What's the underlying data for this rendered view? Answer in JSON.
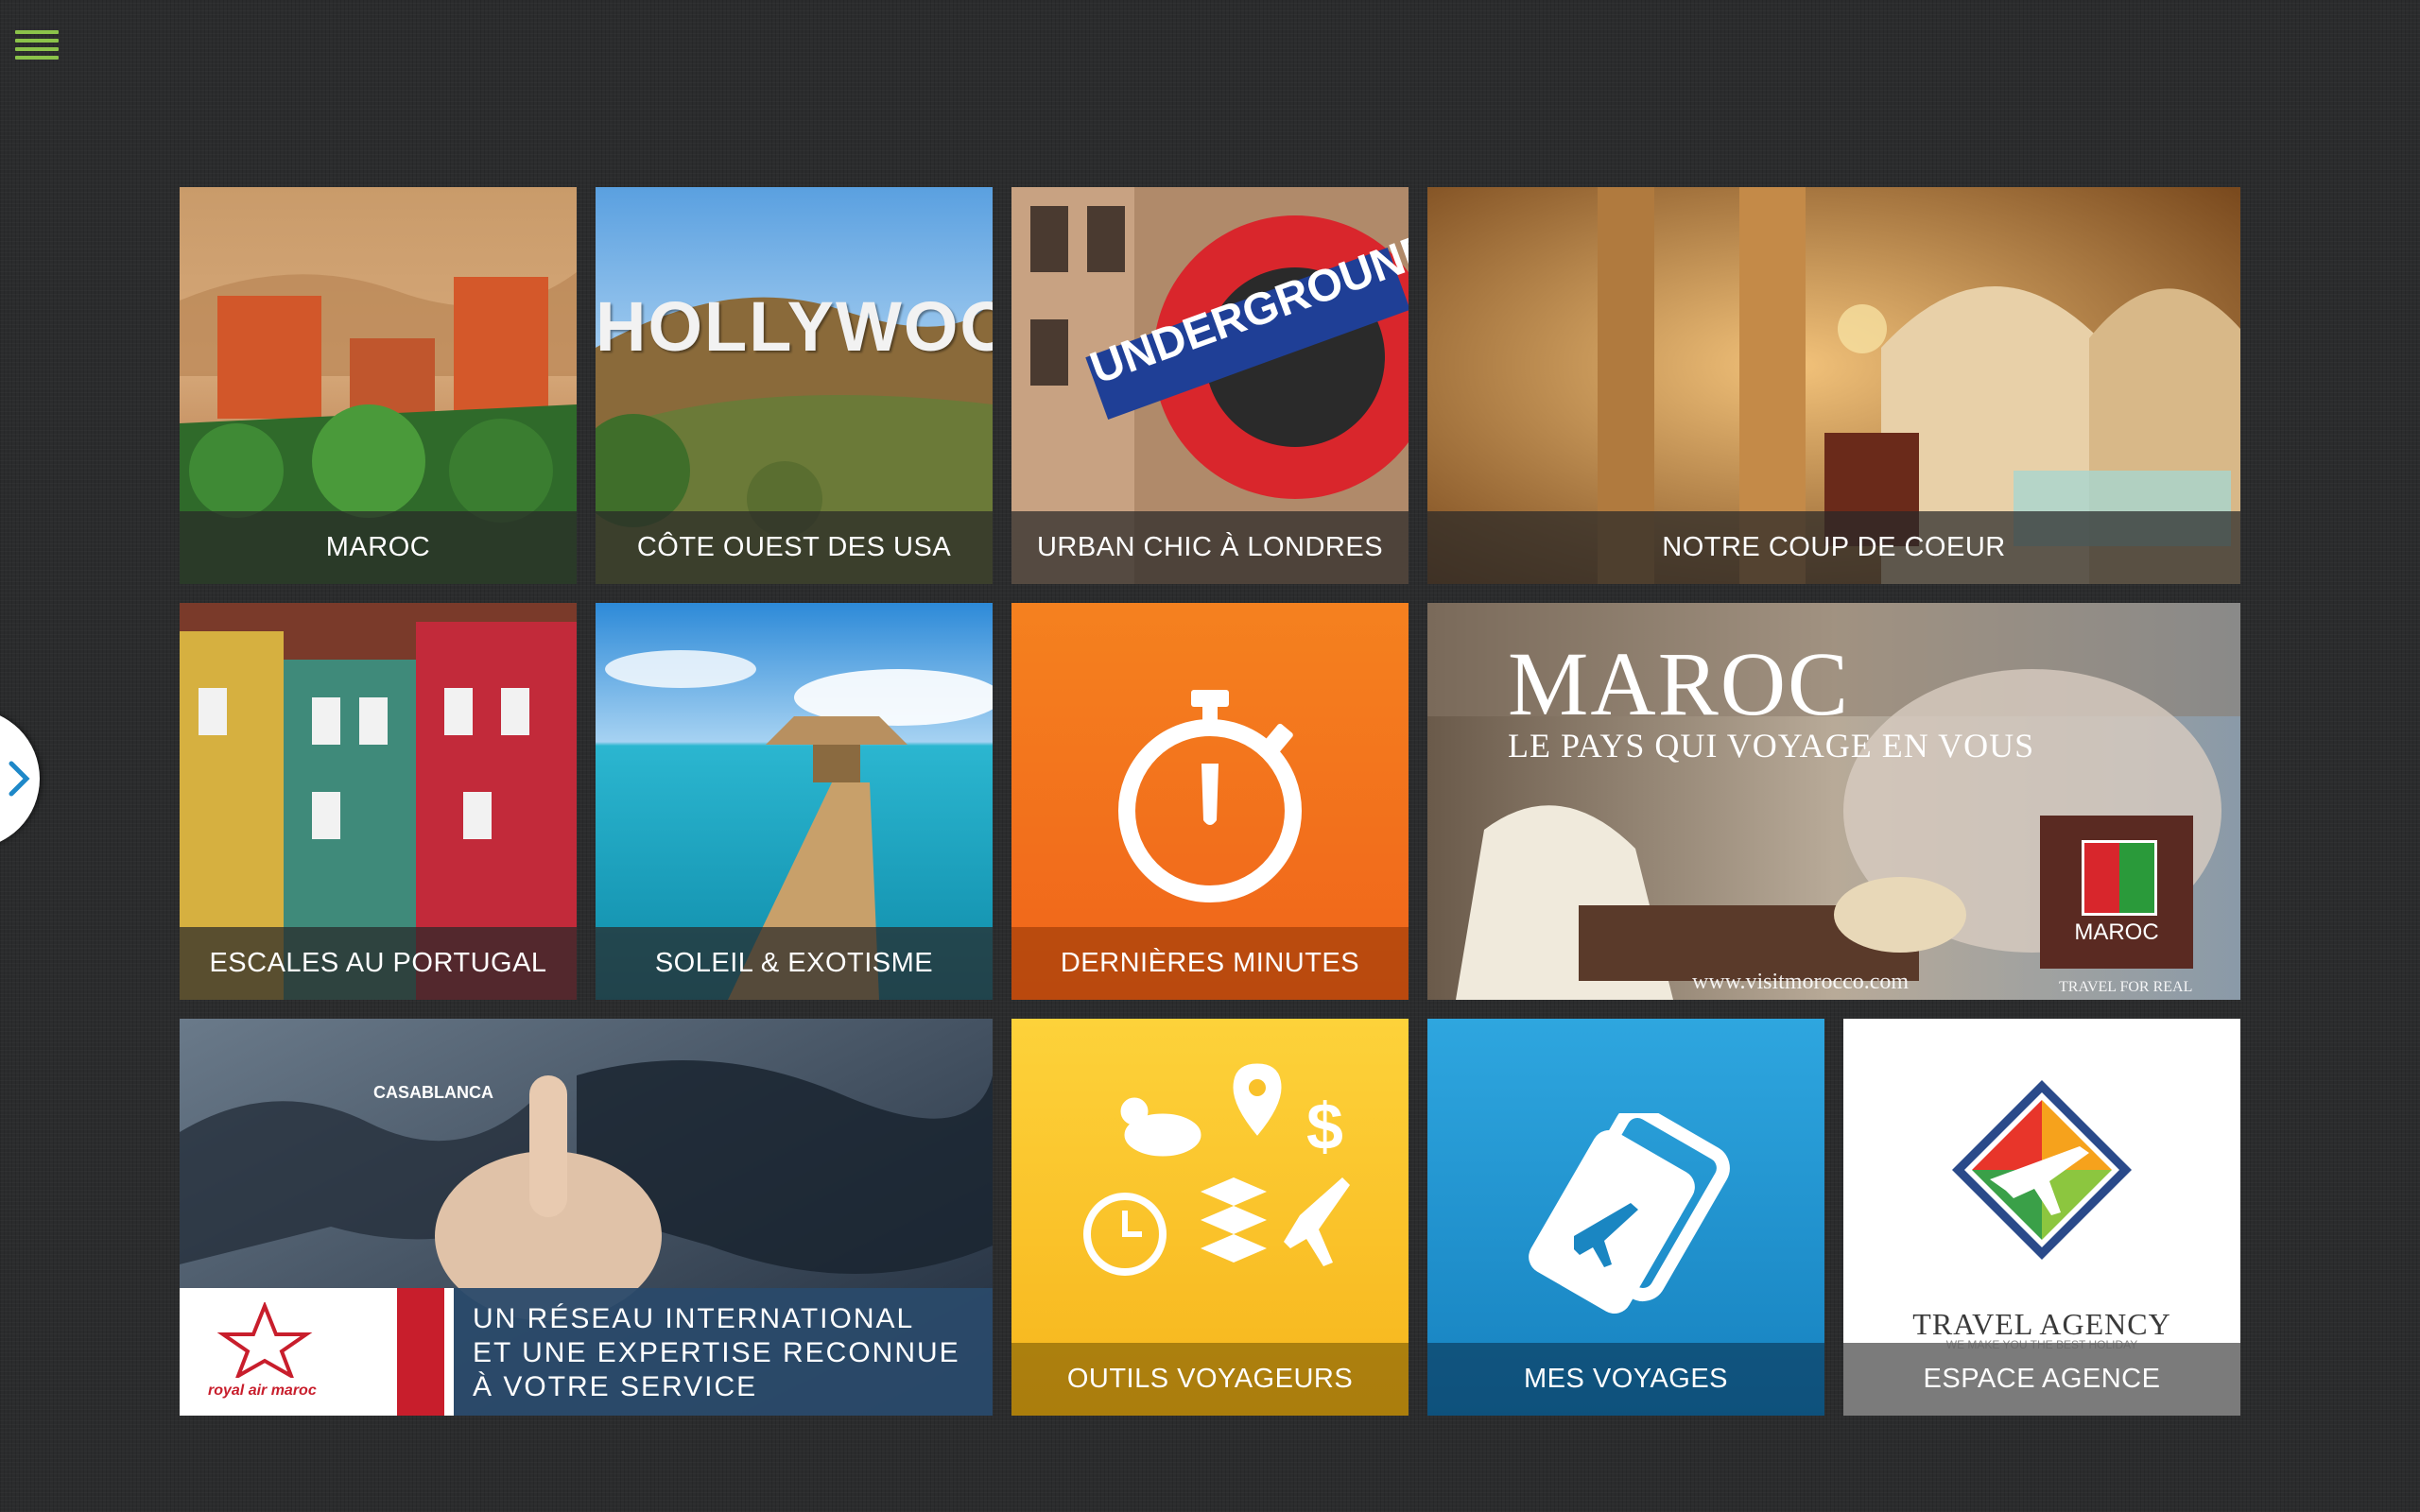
{
  "tiles": [
    {
      "id": "maroc",
      "label": "MAROC"
    },
    {
      "id": "usa",
      "label": "CÔTE OUEST DES USA"
    },
    {
      "id": "londres",
      "label": "URBAN CHIC À LONDRES"
    },
    {
      "id": "coeur",
      "label": "NOTRE COUP DE COEUR"
    },
    {
      "id": "portugal",
      "label": "ESCALES AU PORTUGAL"
    },
    {
      "id": "soleil",
      "label": "SOLEIL & EXOTISME"
    },
    {
      "id": "minutes",
      "label": "DERNIÈRES MINUTES"
    },
    {
      "id": "outils",
      "label": "OUTILS VOYAGEURS"
    },
    {
      "id": "voyages",
      "label": "MES VOYAGES"
    },
    {
      "id": "agence",
      "label": "ESPACE AGENCE"
    }
  ],
  "image_text": {
    "hollywood": "HOLLYWOOD",
    "underground": "UNDERGROUND",
    "maroc_title": "MAROC",
    "maroc_subtitle": "LE PAYS QUI VOYAGE EN VOUS",
    "maroc_badge": "MAROC",
    "maroc_url": "www.visitmorocco.com",
    "maroc_tagline": "TRAVEL FOR REAL",
    "ram_city": "CASABLANCA",
    "ram_line1": "UN RÉSEAU INTERNATIONAL",
    "ram_line2": "ET UNE EXPERTISE RECONNUE",
    "ram_line3": "À VOTRE SERVICE",
    "ram_brand": "royal air maroc",
    "agency_name": "TRAVEL AGENCY",
    "agency_slogan": "WE MAKE YOU THE BEST HOLIDAY"
  },
  "colors": {
    "accent_green": "#8bc34a",
    "orange": "#f57a1d",
    "yellow": "#fbc02d",
    "blue": "#1e9ad6"
  },
  "icons": {
    "menu": "hamburger-icon",
    "side_tab": "chevron-right-icon",
    "minutes": "stopwatch-icon",
    "voyages": "boarding-pass-plane-icon",
    "agence": "travel-agency-logo"
  }
}
